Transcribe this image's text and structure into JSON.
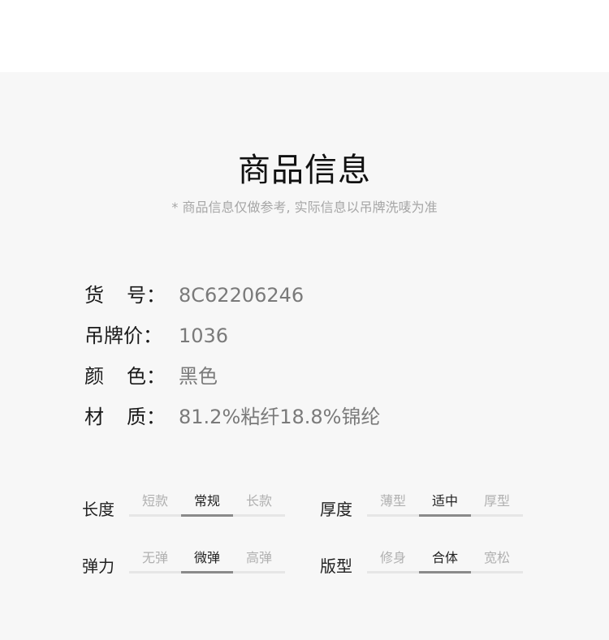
{
  "header": {
    "title": "商品信息",
    "subtitle": "* 商品信息仅做参考, 实际信息以吊牌洗唛为准"
  },
  "info": [
    {
      "label": [
        "货",
        "号："
      ],
      "value": "8C62206246"
    },
    {
      "label": [
        "吊牌价："
      ],
      "value": "1036"
    },
    {
      "label": [
        "颜",
        "色："
      ],
      "value": "黑色"
    },
    {
      "label": [
        "材",
        "质："
      ],
      "value": "81.2%粘纤18.8%锦纶"
    }
  ],
  "attributes": [
    {
      "title": "长度",
      "options": [
        "短款",
        "常规",
        "长款"
      ],
      "selected": "常规"
    },
    {
      "title": "厚度",
      "options": [
        "薄型",
        "适中",
        "厚型"
      ],
      "selected": "适中"
    },
    {
      "title": "弹力",
      "options": [
        "无弹",
        "微弹",
        "高弹"
      ],
      "selected": "微弹"
    },
    {
      "title": "版型",
      "options": [
        "修身",
        "合体",
        "宽松"
      ],
      "selected": "合体"
    }
  ]
}
